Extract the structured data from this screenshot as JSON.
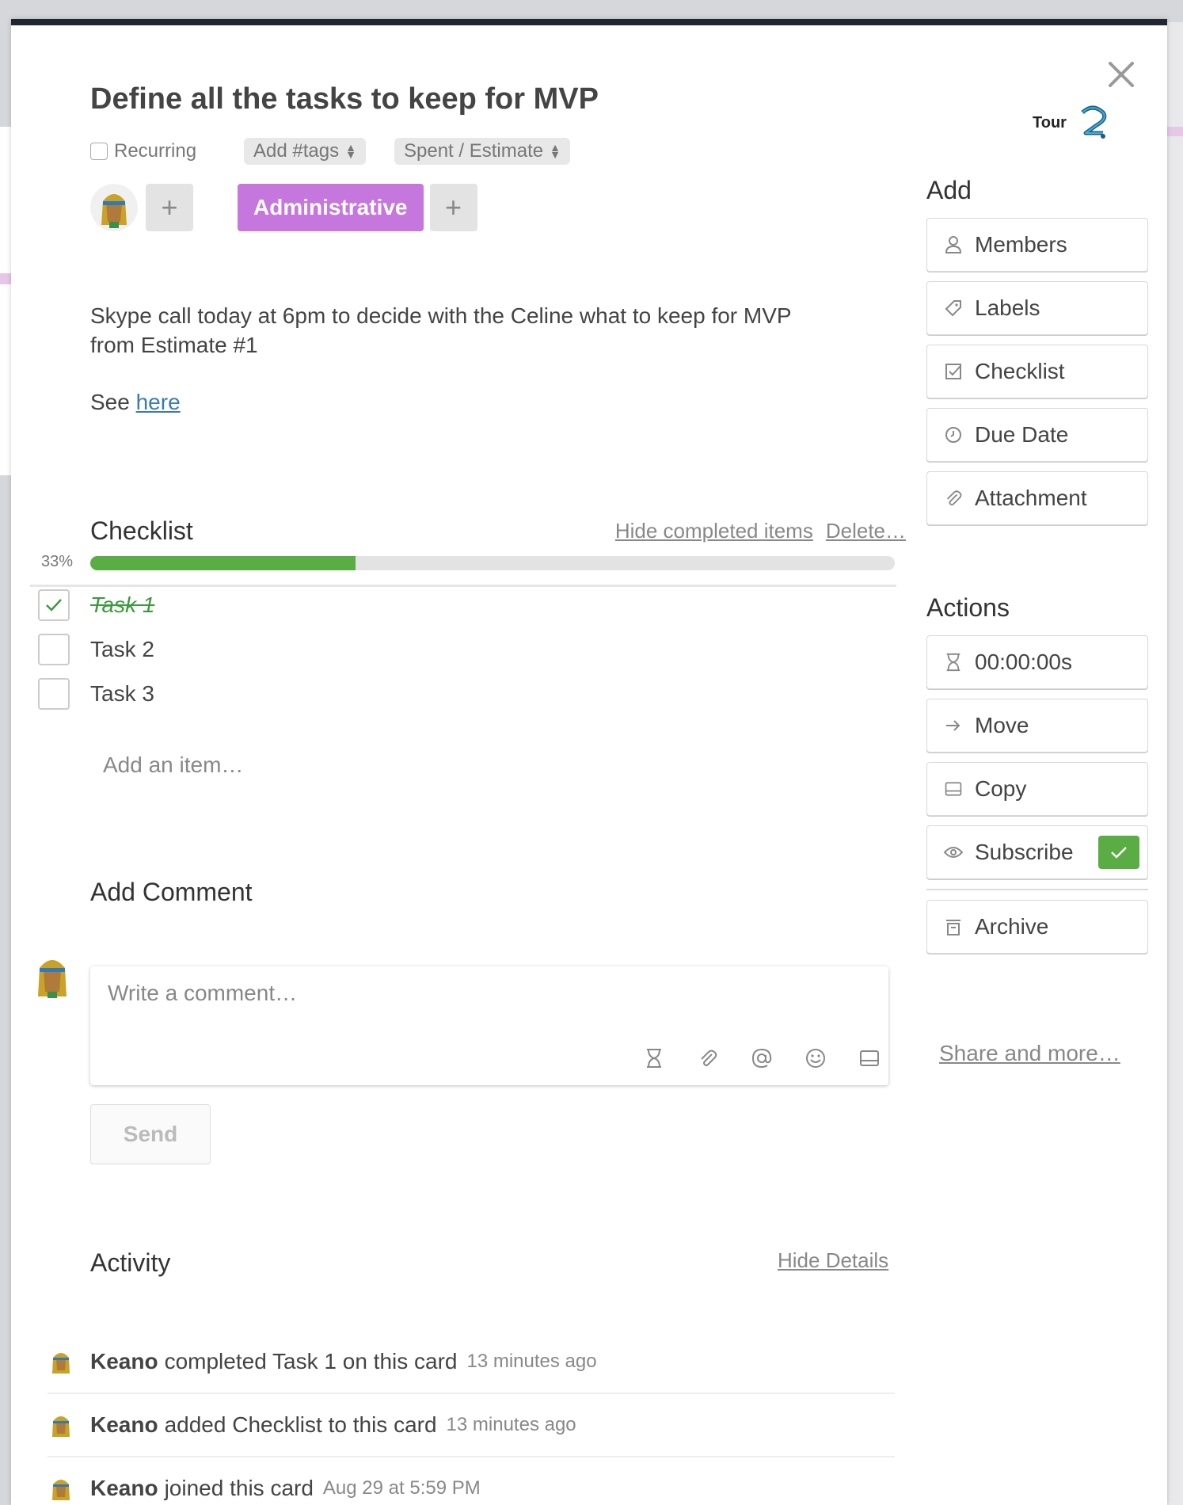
{
  "card": {
    "title": "Define all the tasks to keep for MVP",
    "recurring_label": "Recurring",
    "tags_label": "Add #tags",
    "spent_label": "Spent / Estimate",
    "add_member_label": "+",
    "label_name": "Administrative",
    "add_label_label": "+",
    "description": "Skype call today at 6pm to decide with the Celine what to keep for MVP from Estimate #1",
    "see_prefix": "See",
    "see_link": "here"
  },
  "tour": {
    "label": "Tour"
  },
  "checklist": {
    "title": "Checklist",
    "hide_completed": "Hide completed items",
    "delete": "Delete…",
    "percent_text": "33%",
    "progress": 0.33,
    "items": [
      {
        "label": "Task 1",
        "done": true
      },
      {
        "label": "Task 2",
        "done": false
      },
      {
        "label": "Task 3",
        "done": false
      }
    ],
    "add_item": "Add an item…"
  },
  "comment": {
    "title": "Add Comment",
    "placeholder": "Write a comment…",
    "send_label": "Send",
    "tools": [
      "hourglass-icon",
      "paperclip-icon",
      "at-icon",
      "emoji-icon",
      "card-icon"
    ]
  },
  "activity": {
    "title": "Activity",
    "hide_details": "Hide Details",
    "entries": [
      {
        "who": "Keano",
        "what": "completed Task 1 on this card",
        "when": "13 minutes ago"
      },
      {
        "who": "Keano",
        "what": "added Checklist to this card",
        "when": "13 minutes ago"
      },
      {
        "who": "Keano",
        "what": "joined this card",
        "when": "Aug 29 at 5:59 PM"
      }
    ]
  },
  "sidebar": {
    "add_title": "Add",
    "add_buttons": [
      {
        "label": "Members",
        "icon": "person-icon"
      },
      {
        "label": "Labels",
        "icon": "tag-icon"
      },
      {
        "label": "Checklist",
        "icon": "checkbox-icon"
      },
      {
        "label": "Due Date",
        "icon": "clock-icon"
      },
      {
        "label": "Attachment",
        "icon": "paperclip-icon"
      }
    ],
    "actions_title": "Actions",
    "action_buttons": [
      {
        "label": "00:00:00s",
        "icon": "hourglass-icon"
      },
      {
        "label": "Move",
        "icon": "arrow-right-icon"
      },
      {
        "label": "Copy",
        "icon": "card-icon"
      },
      {
        "label": "Subscribe",
        "icon": "eye-icon",
        "checked": true
      }
    ],
    "archive_label": "Archive",
    "share_more": "Share and more…"
  },
  "colors": {
    "label_purple": "#c677dd",
    "progress_green": "#5aac44",
    "header_bar": "#1f2733",
    "link_blue": "#3b7bb1"
  }
}
